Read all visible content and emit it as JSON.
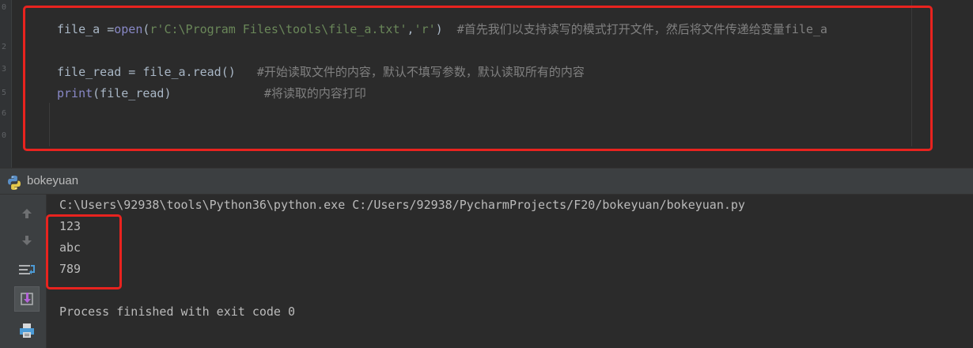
{
  "editor": {
    "gutter_numbers": [
      "0",
      "2",
      "3",
      "5",
      "6",
      "0"
    ],
    "line1": {
      "var": "file_a ",
      "op": "=",
      "fn": "open",
      "p1": "(",
      "str1": "r'C:\\Program Files\\tools\\file_a.txt'",
      "comma": ",",
      "str2": "'r'",
      "p2": ")",
      "comment": "  #首先我们以支持读写的模式打开文件，然后将文件传递给变量file_a"
    },
    "line2": {
      "code": "file_read = file_a.read()",
      "comment": "   #开始读取文件的内容，默认不填写参数，默认读取所有的内容"
    },
    "line3": {
      "fn": "print",
      "args": "(file_read)",
      "comment": "             #将读取的内容打印"
    }
  },
  "run_panel": {
    "title": "bokeyuan",
    "colors": {
      "highlight_box": "#e8231f",
      "console_text": "#bbbbbb",
      "panel_bg": "#3c3f41"
    },
    "console_lines": [
      "C:\\Users\\92938\\tools\\Python36\\python.exe C:/Users/92938/PycharmProjects/F20/bokeyuan/bokeyuan.py",
      "123",
      "abc",
      "789",
      "",
      "Process finished with exit code 0"
    ]
  },
  "icons": {
    "toolbar": [
      "arrow-up-icon",
      "arrow-down-icon",
      "soft-wrap-icon",
      "scroll-to-end-icon",
      "print-icon"
    ]
  }
}
